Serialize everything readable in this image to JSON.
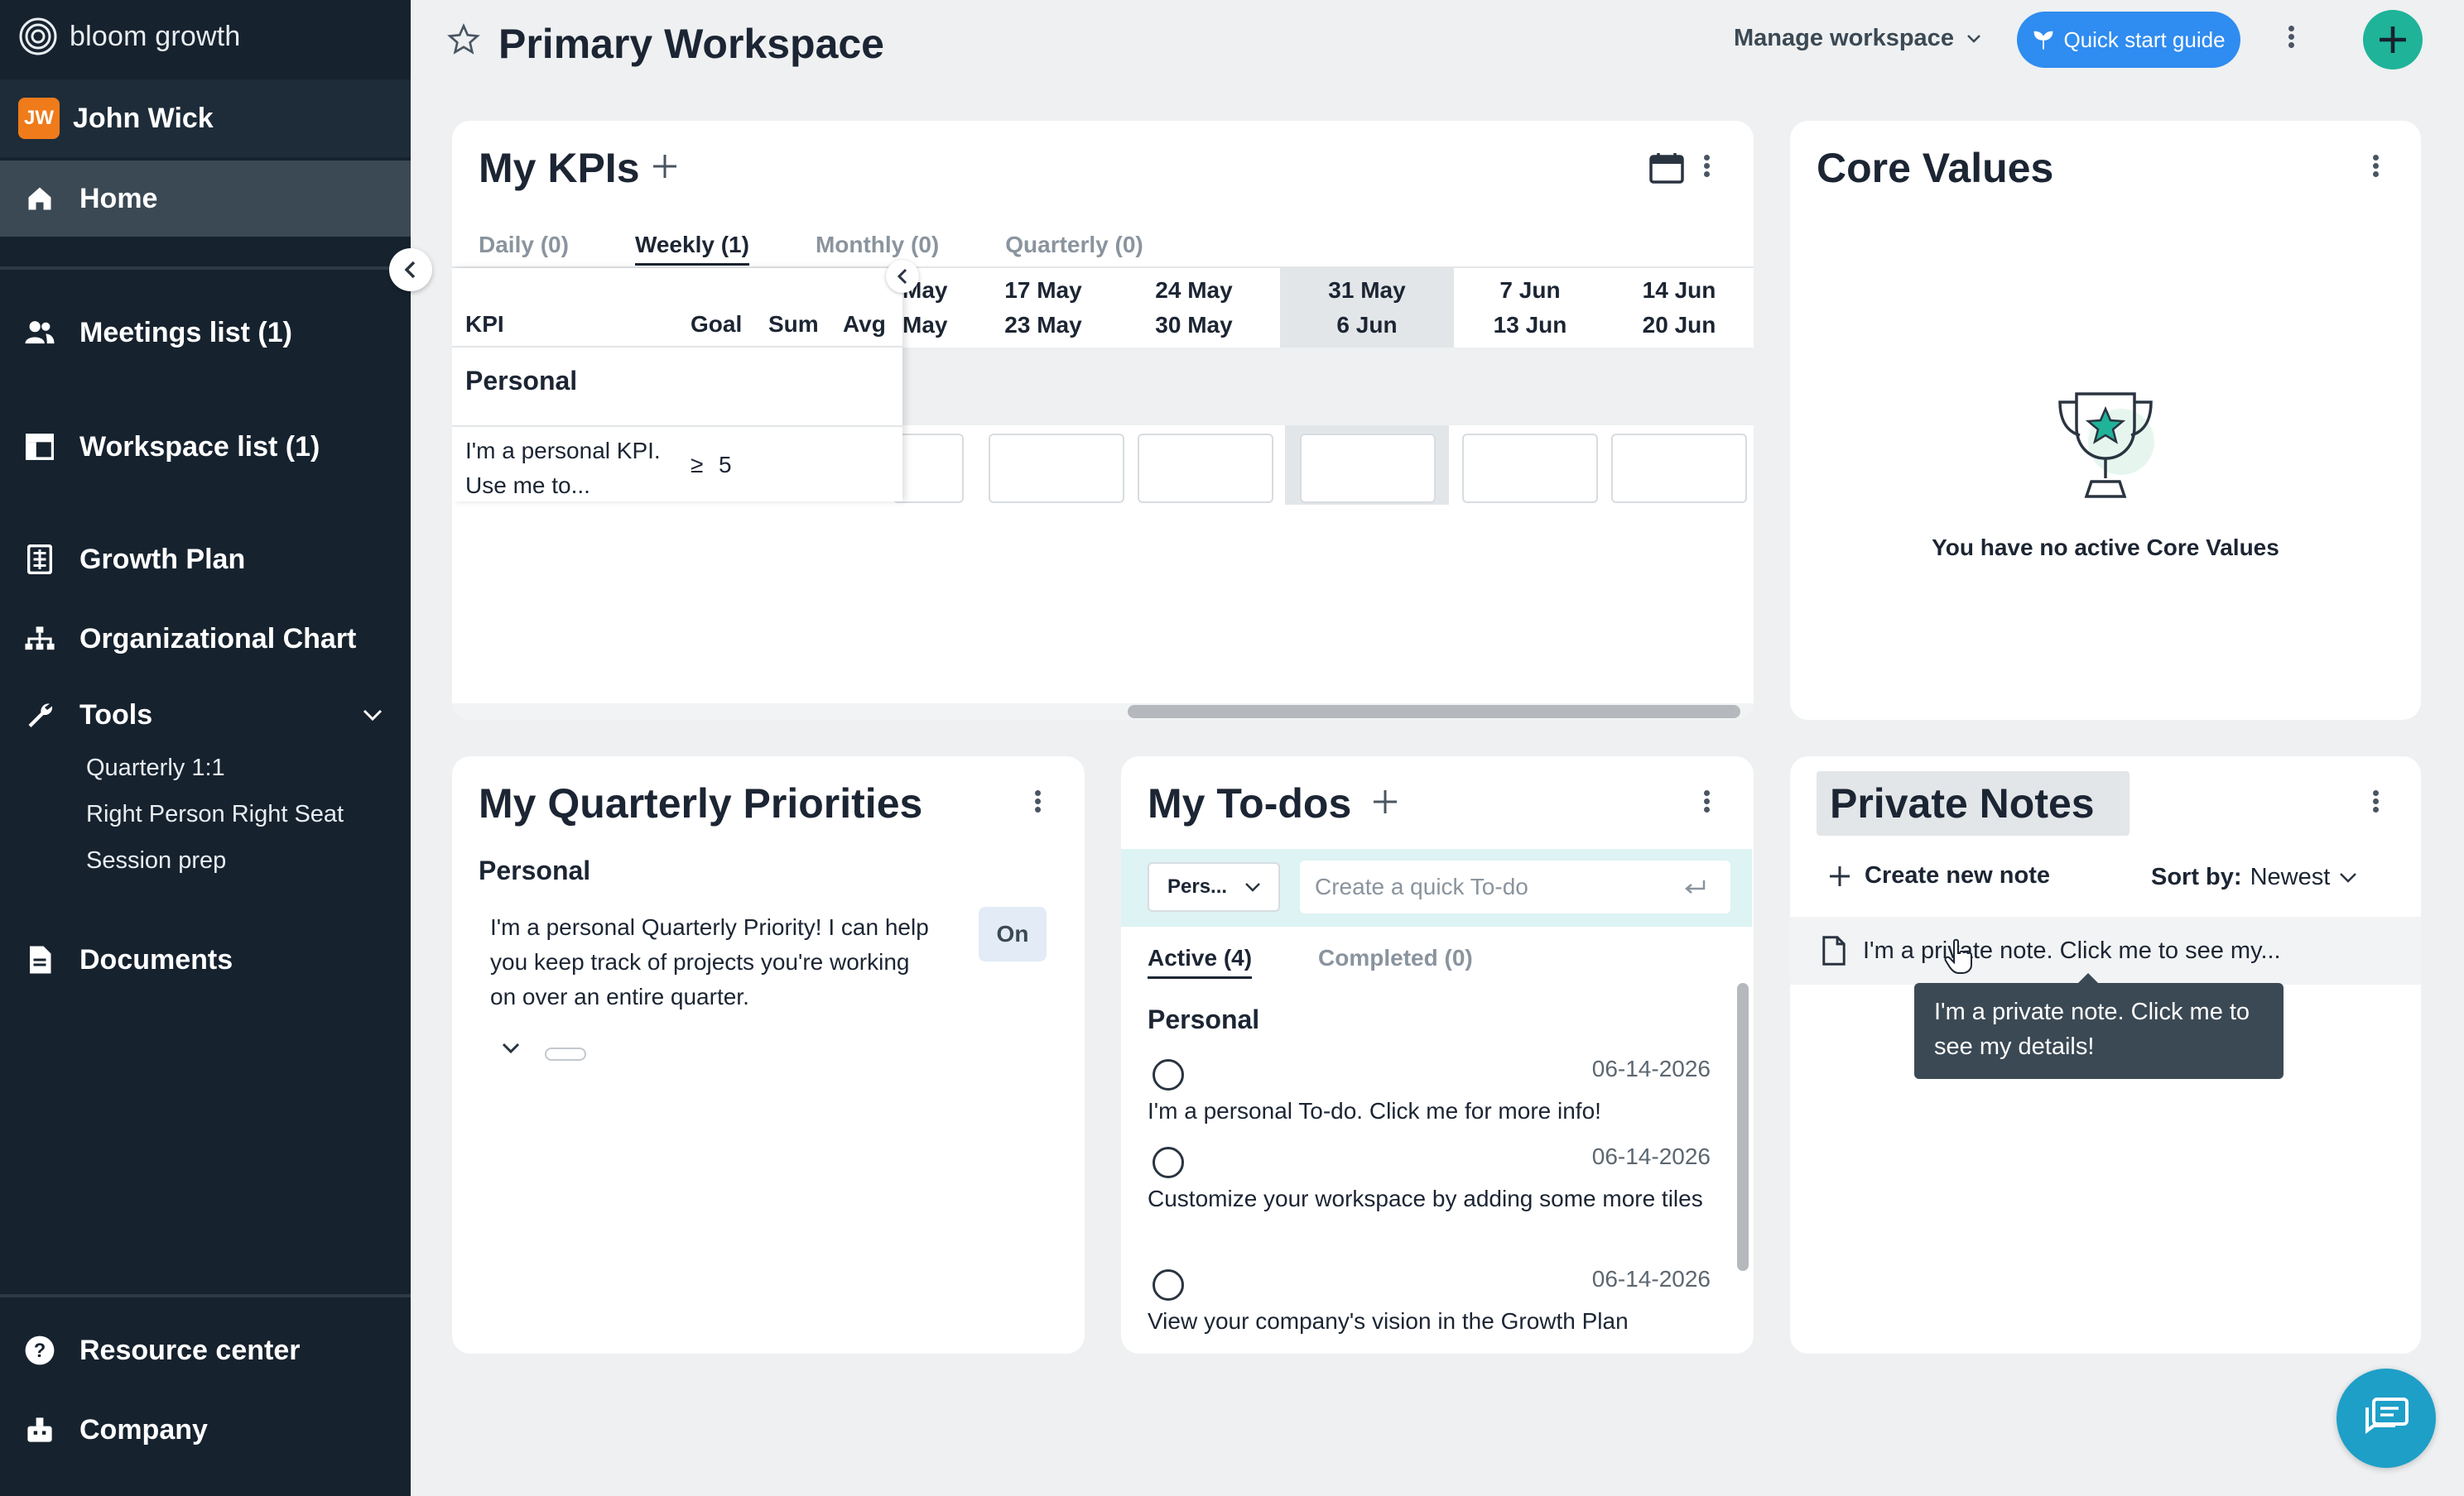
{
  "sidebar": {
    "brand": "bloom growth",
    "user": {
      "initials": "JW",
      "name": "John Wick"
    },
    "nav": {
      "home": "Home",
      "meetings": "Meetings list (1)",
      "workspaces": "Workspace list (1)",
      "growth_plan": "Growth Plan",
      "org_chart": "Organizational Chart",
      "tools": "Tools",
      "tools_items": [
        "Quarterly 1:1",
        "Right Person Right Seat",
        "Session prep"
      ],
      "documents": "Documents",
      "resource_center": "Resource center",
      "company": "Company"
    }
  },
  "header": {
    "title": "Primary Workspace",
    "manage": "Manage workspace",
    "quick_start": "Quick start guide"
  },
  "kpis": {
    "title": "My KPIs",
    "tabs": [
      "Daily (0)",
      "Weekly (1)",
      "Monthly (0)",
      "Quarterly (0)"
    ],
    "active_tab": "Weekly (1)",
    "columns": {
      "kpi": "KPI",
      "goal": "Goal",
      "sum": "Sum",
      "avg": "Avg"
    },
    "weeks": [
      {
        "from": "May",
        "to": "May"
      },
      {
        "from": "17 May",
        "to": "23 May"
      },
      {
        "from": "24 May",
        "to": "30 May"
      },
      {
        "from": "31 May",
        "to": "6 Jun"
      },
      {
        "from": "7 Jun",
        "to": "13 Jun"
      },
      {
        "from": "14 Jun",
        "to": "20 Jun"
      }
    ],
    "current_week": "31 May",
    "group": "Personal",
    "row": {
      "name": "I'm a personal KPI. Use me to...",
      "goal_op": "≥",
      "goal": "5"
    }
  },
  "core_values": {
    "title": "Core Values",
    "empty": "You have no active Core Values"
  },
  "quarterly": {
    "title": "My Quarterly Priorities",
    "section": "Personal",
    "item": "I'm a personal Quarterly Priority! I can help you keep track of projects you're working on over an entire quarter.",
    "status": "On"
  },
  "todos": {
    "title": "My To-dos",
    "owner_select": "Pers...",
    "placeholder": "Create a quick To-do",
    "tabs": [
      "Active (4)",
      "Completed (0)"
    ],
    "active_tab": "Active (4)",
    "section": "Personal",
    "items": [
      {
        "date": "06-14-2026",
        "text": "I'm a personal To-do. Click me for more info!"
      },
      {
        "date": "06-14-2026",
        "text": "Customize your workspace by adding some more tiles"
      },
      {
        "date": "06-14-2026",
        "text": "View your company's vision in the Growth Plan"
      }
    ]
  },
  "notes": {
    "title": "Private Notes",
    "create": "Create new note",
    "sort_label": "Sort by:",
    "sort_value": "Newest",
    "item": "I'm a private note. Click me to see my...",
    "tooltip": "I'm a private note. Click me to see my details!"
  },
  "colors": {
    "sidebar_bg": "#16222e",
    "accent_blue": "#2f8cf0",
    "accent_green": "#1fb39a",
    "avatar_orange": "#ef7b1a",
    "chat_blue": "#1e9fc8"
  }
}
